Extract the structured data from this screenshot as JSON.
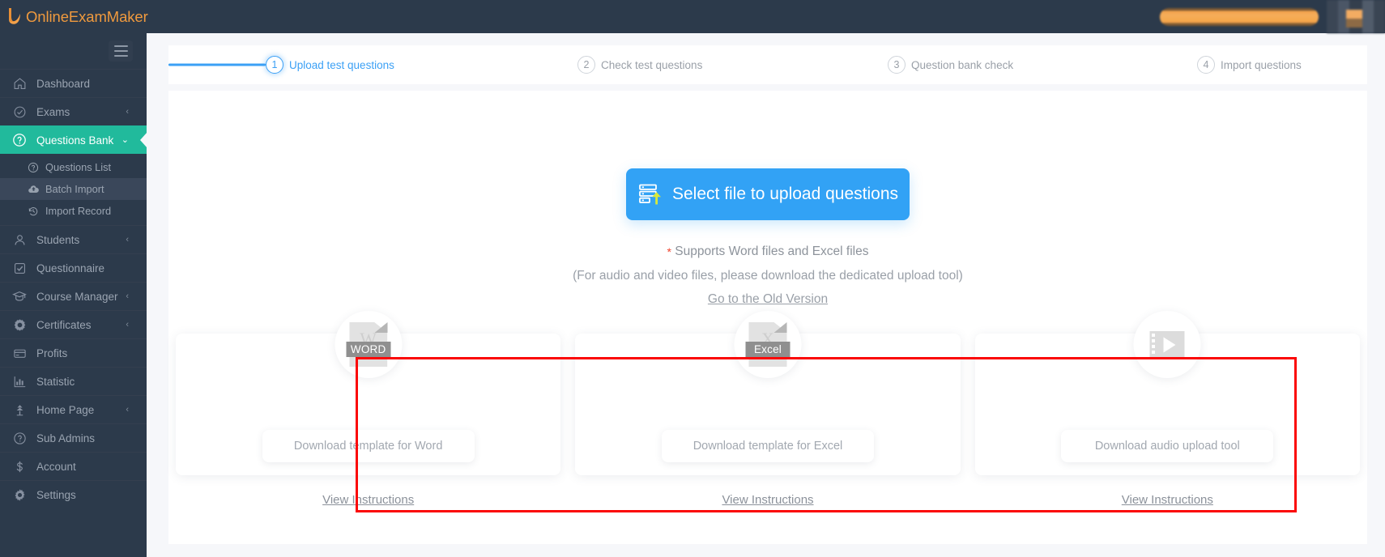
{
  "app": {
    "brand_name": "OnlineExamMaker",
    "brand_color": "#f09a3e",
    "topbar_bg": "#2c3a4b",
    "accent_color": "#21ba9c",
    "primary_blue": "#32a2f5",
    "highlight_red": "#fb0606"
  },
  "topbar": {
    "redacted_pill": "",
    "redacted_block": ""
  },
  "sidebar": {
    "menu_toggle_icon": "hamburger-icon",
    "items": [
      {
        "label": "Dashboard",
        "icon": "home-icon",
        "has_chevron": false,
        "active": false
      },
      {
        "label": "Exams",
        "icon": "check-circle-icon",
        "has_chevron": true,
        "chevron": "‹",
        "active": false
      },
      {
        "label": "Questions Bank",
        "icon": "question-circle-icon",
        "has_chevron": true,
        "chevron": "⌄",
        "active": true
      },
      {
        "label": "Students",
        "icon": "user-icon",
        "has_chevron": true,
        "chevron": "‹",
        "active": false
      },
      {
        "label": "Questionnaire",
        "icon": "checkbox-icon",
        "has_chevron": false,
        "active": false
      },
      {
        "label": "Course Manager",
        "icon": "graduation-cap-icon",
        "has_chevron": true,
        "chevron": "‹",
        "active": false
      },
      {
        "label": "Certificates",
        "icon": "badge-icon",
        "has_chevron": true,
        "chevron": "‹",
        "active": false
      },
      {
        "label": "Profits",
        "icon": "card-icon",
        "has_chevron": false,
        "active": false
      },
      {
        "label": "Statistic",
        "icon": "bar-chart-icon",
        "has_chevron": false,
        "active": false
      },
      {
        "label": "Home Page",
        "icon": "plant-icon",
        "has_chevron": true,
        "chevron": "‹",
        "active": false
      },
      {
        "label": "Sub Admins",
        "icon": "question-circle-icon",
        "has_chevron": false,
        "active": false
      },
      {
        "label": "Account",
        "icon": "dollar-icon",
        "has_chevron": false,
        "active": false
      },
      {
        "label": "Settings",
        "icon": "gear-icon",
        "has_chevron": false,
        "active": false
      }
    ],
    "submenu": [
      {
        "label": "Questions List",
        "icon": "question-circle-icon",
        "selected": false
      },
      {
        "label": "Batch Import",
        "icon": "cloud-upload-icon",
        "selected": true
      },
      {
        "label": "Import Record",
        "icon": "history-icon",
        "selected": false
      }
    ]
  },
  "stepper": {
    "steps": [
      {
        "num": "1",
        "label": "Upload test questions",
        "state": "current"
      },
      {
        "num": "2",
        "label": "Check test questions",
        "state": "pending"
      },
      {
        "num": "3",
        "label": "Question bank check",
        "state": "pending"
      },
      {
        "num": "4",
        "label": "Import questions",
        "state": "pending"
      }
    ]
  },
  "main": {
    "upload_button": {
      "label": "Select file to upload questions",
      "icon": "file-upload-icon"
    },
    "note_star": "*",
    "note_supports": " Supports Word files and Excel files",
    "note_audio": "(For audio and video files, please download the dedicated upload tool)",
    "old_version_link": "Go to the Old Version",
    "templates": [
      {
        "icon": "word-file-icon",
        "icon_letter": "W",
        "icon_band": "WORD",
        "button_label": "Download template for Word",
        "instructions_label": "View Instructions"
      },
      {
        "icon": "excel-file-icon",
        "icon_letter": "X",
        "icon_band": "Excel",
        "button_label": "Download template for Excel",
        "instructions_label": "View Instructions"
      },
      {
        "icon": "video-file-icon",
        "icon_letter": "",
        "icon_band": "",
        "button_label": "Download audio upload tool",
        "instructions_label": "View Instructions"
      }
    ]
  }
}
